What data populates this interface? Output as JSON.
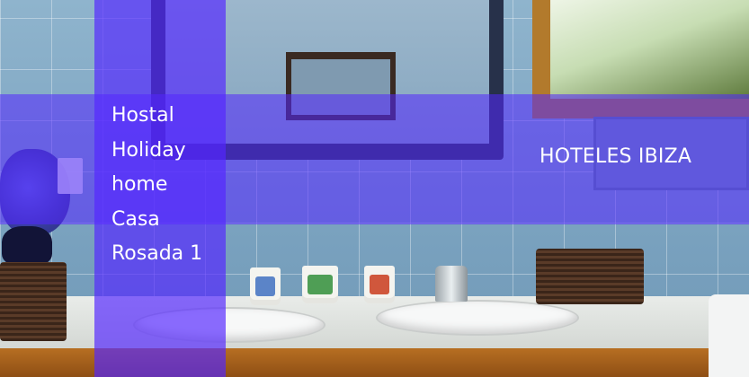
{
  "hotel": {
    "title": "Hostal Holiday home Casa Rosada 1"
  },
  "category": {
    "label": "HOTELES IBIZA"
  },
  "colors": {
    "overlay_accent": "#5426ff",
    "text": "#ffffff"
  }
}
